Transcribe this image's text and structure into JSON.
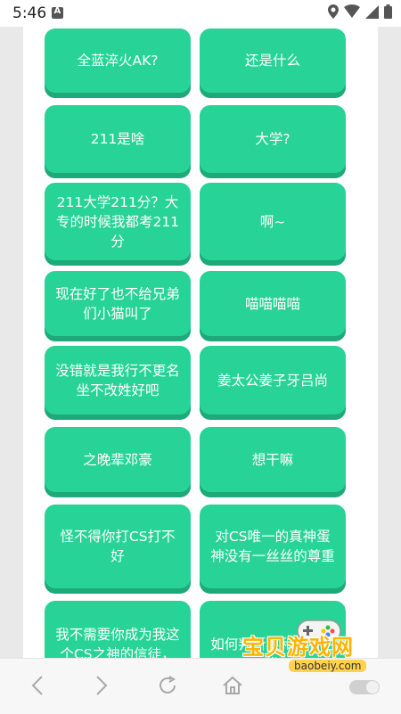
{
  "status_bar": {
    "time": "5:46"
  },
  "messages": [
    [
      "全蓝淬火AK?",
      "还是什么"
    ],
    [
      "211是啥",
      "大学?"
    ],
    [
      "211大学211分？大专的时候我都考211分",
      "啊~"
    ],
    [
      "现在好了也不给兄弟们小猫叫了",
      "喵喵喵喵"
    ],
    [
      "没错就是我行不更名坐不改姓好吧",
      "姜太公姜子牙吕尚"
    ],
    [
      "之晚辈邓豪",
      "想干嘛"
    ],
    [
      "怪不得你打CS打不好",
      "对CS唯一的真神蛋神没有一丝丝的尊重"
    ],
    [
      "我不需要你成为我这个CS之神的信徒，但你起码要对",
      "如何判断狼和狗看毛发"
    ]
  ],
  "nav": {
    "back_icon": "chevron-left-icon",
    "forward_icon": "chevron-right-icon",
    "refresh_icon": "refresh-icon",
    "home_icon": "home-icon"
  },
  "watermark": {
    "logo_text": "宝贝游戏网",
    "url": "baobeiy.com"
  },
  "colors": {
    "bubble": "#27d396",
    "bubble_shadow": "#1ea97a",
    "panel": "#ffffff",
    "background": "#e9e9e9"
  }
}
